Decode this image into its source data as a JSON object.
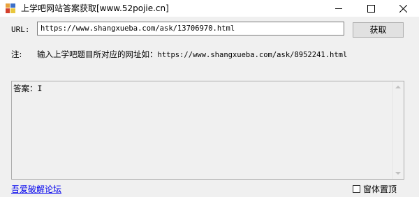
{
  "window": {
    "title": "上学吧网站答案获取[www.52pojie.cn]",
    "icon": "app-icon"
  },
  "url_row": {
    "label": "URL:",
    "value": "https://www.shangxueba.com/ask/13706970.html",
    "button_label": "获取"
  },
  "note": {
    "label": "注:",
    "text": "输入上学吧题目所对应的网址如：",
    "example_url": "https://www.shangxueba.com/ask/8952241.html"
  },
  "answer": {
    "text": "答案：I"
  },
  "footer": {
    "link_label": "吾爱破解论坛",
    "topmost_label": "窗体置顶",
    "topmost_checked": false
  }
}
